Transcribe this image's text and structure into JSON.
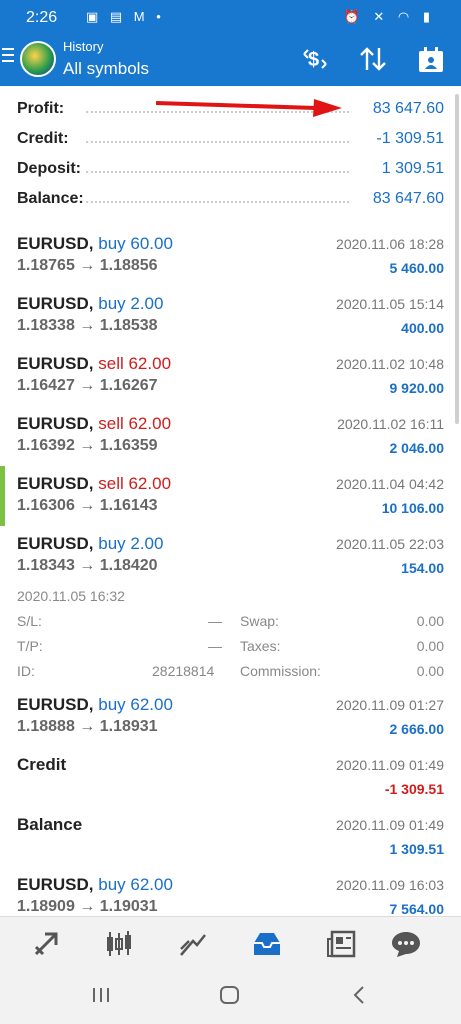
{
  "status": {
    "time": "2:26",
    "left_icons": "▣ ▤ M •",
    "right_icons": "⏰ ✕ ◠ ▮"
  },
  "header": {
    "subtitle": "History",
    "title": "All symbols"
  },
  "summary": [
    {
      "label": "Profit:",
      "value": "83 647.60"
    },
    {
      "label": "Credit:",
      "value": "-1 309.51"
    },
    {
      "label": "Deposit:",
      "value": "1 309.51"
    },
    {
      "label": "Balance:",
      "value": "83 647.60"
    }
  ],
  "deals": [
    {
      "symbol": "EURUSD,",
      "action": "buy 60.00",
      "prices": "1.18765 → 1.18856",
      "time": "2020.11.06 18:28",
      "profit": "5 460.00"
    },
    {
      "symbol": "EURUSD,",
      "action": "buy 2.00",
      "prices": "1.18338 → 1.18538",
      "time": "2020.11.05 15:14",
      "profit": "400.00"
    },
    {
      "symbol": "EURUSD,",
      "action": "sell 62.00",
      "prices": "1.16427 → 1.16267",
      "time": "2020.11.02 10:48",
      "profit": "9 920.00"
    },
    {
      "symbol": "EURUSD,",
      "action": "sell 62.00",
      "prices": "1.16392 → 1.16359",
      "time": "2020.11.02 16:11",
      "profit": "2 046.00"
    },
    {
      "symbol": "EURUSD,",
      "action": "sell 62.00",
      "prices": "1.16306 → 1.16143",
      "time": "2020.11.04 04:42",
      "profit": "10 106.00"
    },
    {
      "symbol": "EURUSD,",
      "action": "buy 2.00",
      "prices": "1.18343 → 1.18420",
      "time": "2020.11.05 22:03",
      "profit": "154.00"
    },
    {
      "symbol": "EURUSD,",
      "action": "buy 62.00",
      "prices": "1.18888 → 1.18931",
      "time": "2020.11.09 01:27",
      "profit": "2 666.00"
    },
    {
      "symbol": "Credit",
      "time": "2020.11.09 01:49",
      "profit": "-1 309.51"
    },
    {
      "symbol": "Balance",
      "time": "2020.11.09 01:49",
      "profit": "1 309.51"
    },
    {
      "symbol": "EURUSD,",
      "action": "buy 62.00",
      "prices": "1.18909 → 1.19031",
      "time": "2020.11.09 16:03",
      "profit": "7 564.00"
    }
  ],
  "expanded": {
    "open_time": "2020.11.05 16:32",
    "sl_label": "S/L:",
    "sl_value": "—",
    "tp_label": "T/P:",
    "tp_value": "—",
    "id_label": "ID:",
    "id_value": "28218814",
    "swap_label": "Swap:",
    "swap_value": "0.00",
    "taxes_label": "Taxes:",
    "taxes_value": "0.00",
    "commission_label": "Commission:",
    "commission_value": "0.00"
  },
  "icons": {
    "menu": "menu-icon",
    "currency": "currency-exchange-icon",
    "sort": "sort-icon",
    "calendar": "calendar-icon"
  },
  "bottom_nav": [
    {
      "name": "quotes-icon",
      "glyph": "⇗"
    },
    {
      "name": "chart-icon",
      "glyph": "╫"
    },
    {
      "name": "trade-icon",
      "glyph": "⟋"
    },
    {
      "name": "history-icon",
      "glyph": "▣"
    },
    {
      "name": "news-icon",
      "glyph": "▤"
    },
    {
      "name": "chat-icon",
      "glyph": "●"
    }
  ],
  "colors": {
    "accent": "#1877cf",
    "buy": "#1a6fc9",
    "sell": "#d21c1c",
    "marker": "#7cc142",
    "arrow": "#e01414"
  }
}
